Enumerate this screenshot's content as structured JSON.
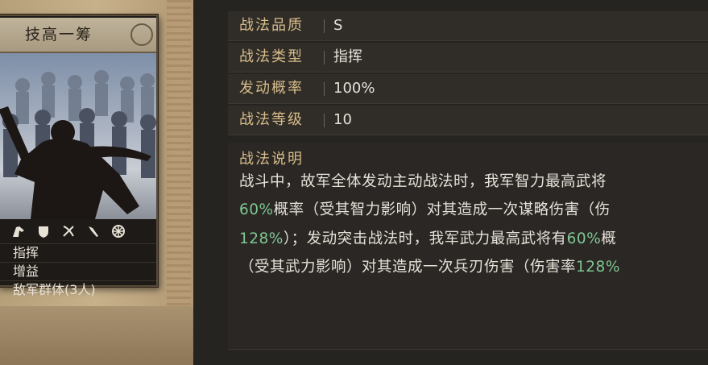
{
  "card": {
    "title": "技高一筹",
    "attributes": [
      {
        "value": "指挥"
      },
      {
        "value": "增益"
      },
      {
        "value": "敌军群体(3人)"
      }
    ],
    "icons": [
      "cavalry-icon",
      "shield-icon",
      "archer-icon",
      "spear-icon",
      "wheel-icon"
    ]
  },
  "info": {
    "rows": [
      {
        "label": "战法品质",
        "value": "S"
      },
      {
        "label": "战法类型",
        "value": "指挥"
      },
      {
        "label": "发动概率",
        "value": "100%"
      },
      {
        "label": "战法等级",
        "value": "10"
      }
    ],
    "description": {
      "title": "战法说明",
      "line1": "战斗中，故军全体发动主动战法时，我军智力最高武将",
      "line2_pct": "60%",
      "line2_text": "概率（受其智力影响）对其造成一次谋略伤害（伤",
      "line3_pct": "128%",
      "line3_text": "）；发动突击战法时，我军武力最高武将有",
      "line3_pct2": "60%",
      "line3_tail": "概",
      "line4_text": "（受其武力影响）对其造成一次兵刃伤害（伤害率",
      "line4_pct": "128%"
    }
  },
  "colors": {
    "label": "#d8bd8a",
    "value": "#e6e1d8",
    "highlight": "#7fc792",
    "row_bg": "#302d29",
    "page_bg": "#262421"
  }
}
